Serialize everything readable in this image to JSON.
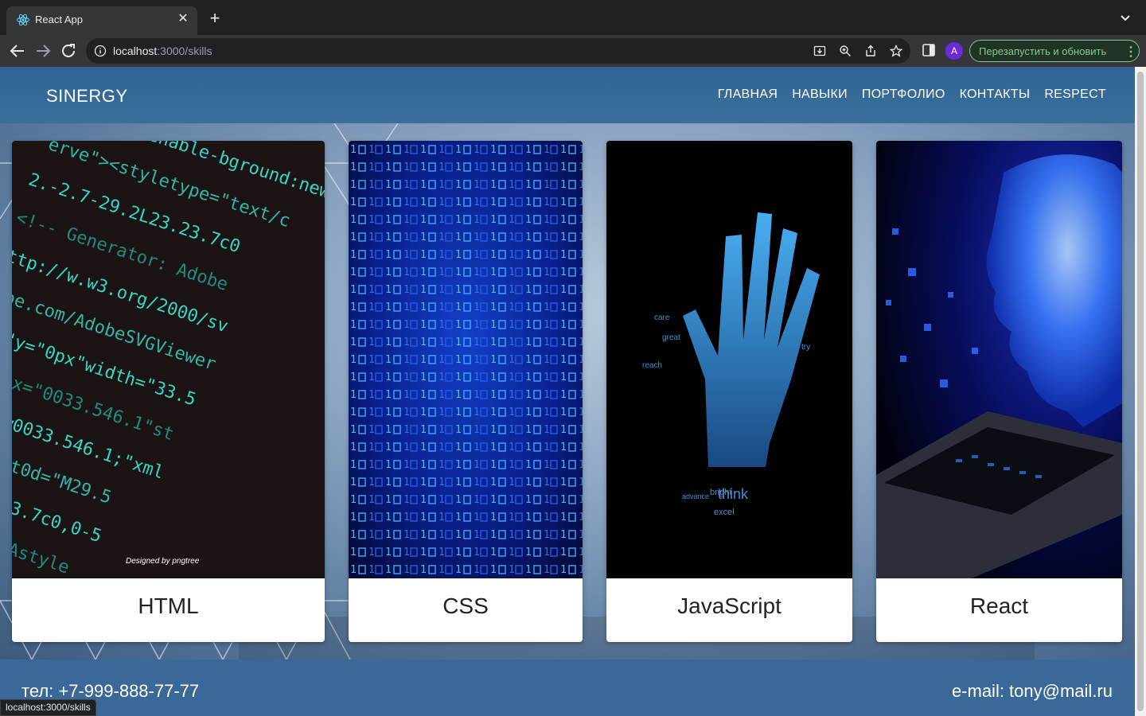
{
  "browser": {
    "tab": {
      "title": "React App",
      "favicon": "react-icon",
      "close_glyph": "✕"
    },
    "new_tab_glyph": "+",
    "address": {
      "host": "localhost",
      "path": ":3000/skills"
    },
    "avatar_letter": "A",
    "relaunch_label": "Перезапустить и обновить",
    "status_url": "localhost:3000/skills"
  },
  "site": {
    "logo": "SINERGY",
    "nav": [
      "ГЛАВНАЯ",
      "НАВЫКИ",
      "ПОРТФОЛИО",
      "КОНТАКТЫ",
      "RESPECT"
    ],
    "cards": [
      {
        "label": "HTML",
        "image": "code-text-image",
        "credit": "Designed by pngtree"
      },
      {
        "label": "CSS",
        "image": "binary-matrix-image"
      },
      {
        "label": "JavaScript",
        "image": "glowing-hand-image"
      },
      {
        "label": "React",
        "image": "digital-brain-laptop-image"
      }
    ],
    "footer": {
      "phone": "тел: +7-999-888-77-77",
      "email": "e-mail: tony@mail.ru"
    }
  },
  "colors": {
    "header": "#2f6494",
    "footer": "#3a6898",
    "chrome_dark": "#202124",
    "chrome_toolbar": "#35363a",
    "relaunch_green": "#81c995",
    "avatar": "#6b2bd9"
  }
}
